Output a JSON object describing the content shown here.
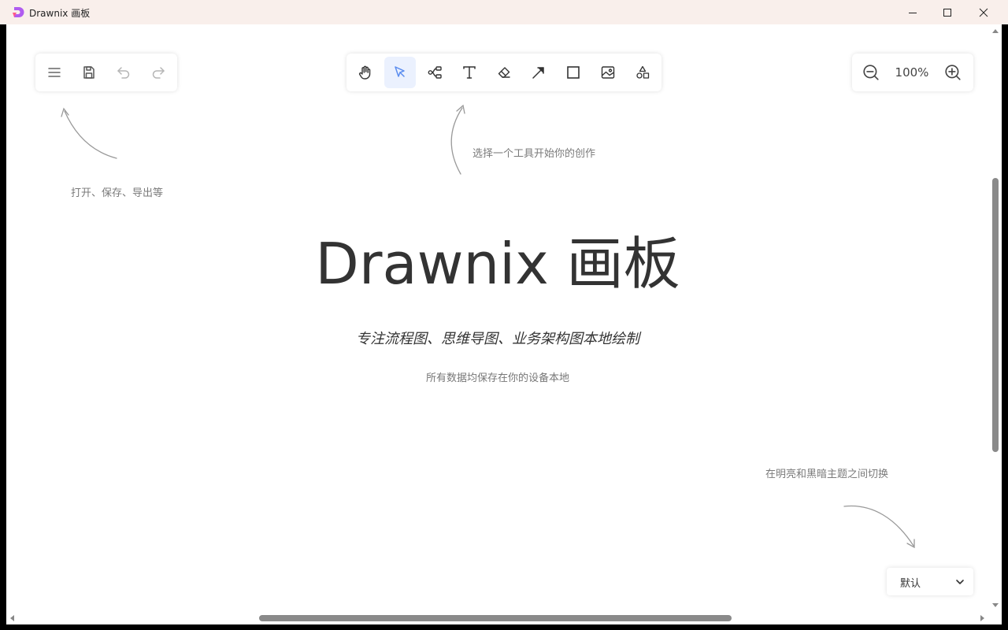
{
  "window": {
    "title": "Drawnix 画板",
    "controls": [
      "minimize-icon",
      "maximize-icon",
      "close-icon"
    ]
  },
  "app_toolbar": {
    "items": [
      "menu-icon",
      "save-icon",
      "undo-icon",
      "redo-icon"
    ]
  },
  "draw_toolbar": {
    "items": [
      "hand-icon",
      "pointer-icon",
      "mindmap-icon",
      "text-icon",
      "eraser-icon",
      "arrow-icon",
      "rectangle-icon",
      "image-icon",
      "shapes-icon"
    ],
    "selected": "pointer-icon",
    "accent": "#5b8def"
  },
  "zoom": {
    "label": "100%"
  },
  "hints": {
    "app_menu": "打开、保存、导出等",
    "tools": "选择一个工具开始你的创作",
    "theme": "在明亮和黑暗主题之间切换"
  },
  "hero": {
    "title": "Drawnix 画板",
    "subtitle": "专注流程图、思维导图、业务架构图本地绘制",
    "note": "所有数据均保存在你的设备本地"
  },
  "theme_select": {
    "value": "默认"
  }
}
